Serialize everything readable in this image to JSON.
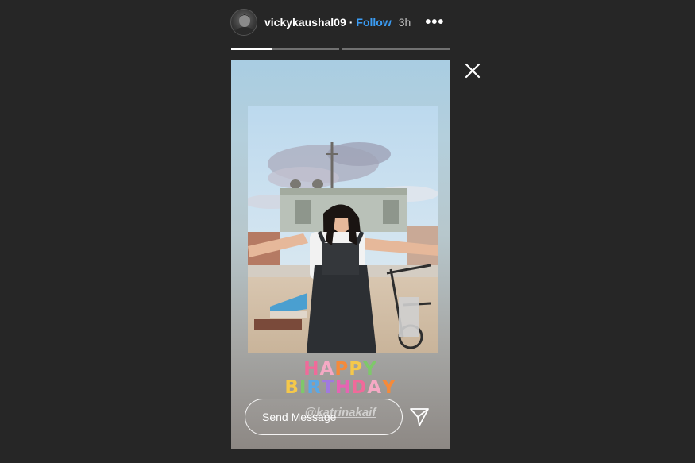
{
  "header": {
    "username": "vickykaushal09",
    "separator": "·",
    "follow_label": "Follow",
    "time_ago": "3h",
    "more_icon": "more-horizontal-icon"
  },
  "progress": {
    "segments": [
      {
        "state": "active",
        "fill_fraction": 0.38
      },
      {
        "state": "pending",
        "fill_fraction": 0
      }
    ]
  },
  "close_icon": "close-icon",
  "story": {
    "sticker_line1": "HAPPY",
    "sticker_line2": "BIRTHDAY",
    "sticker_colors": [
      "#f06a9a",
      "#f5a9c4",
      "#f58a3a",
      "#f5c84a",
      "#7ec86a",
      "#5aa8e6",
      "#a07ae0",
      "#e664b3"
    ],
    "mention": "@katrinakaif",
    "message_placeholder": "Send Message",
    "send_icon": "paper-plane-icon"
  },
  "colors": {
    "background": "#262626",
    "follow": "#3b9df5",
    "text": "#ffffff"
  }
}
